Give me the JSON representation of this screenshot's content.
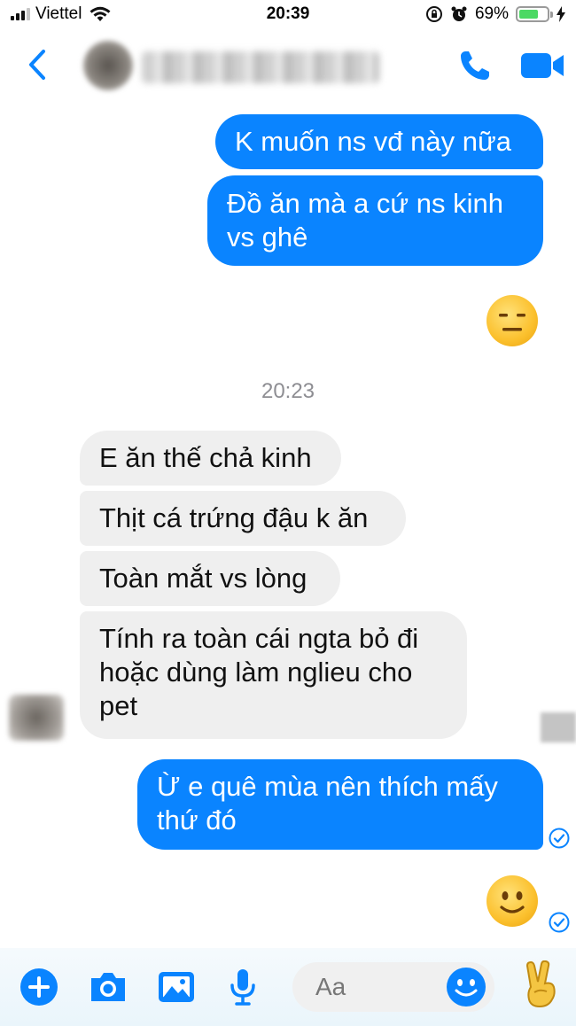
{
  "status_bar": {
    "carrier": "Viettel",
    "time": "20:39",
    "battery_percent": "69%",
    "battery_level": 0.69,
    "icons": [
      "signal-icon",
      "wifi-icon",
      "orientation-lock-icon",
      "alarm-icon",
      "battery-icon",
      "charging-bolt-icon"
    ]
  },
  "header": {
    "icons": [
      "back-chevron-icon",
      "phone-icon",
      "video-camera-icon"
    ]
  },
  "colors": {
    "accent": "#0a84ff",
    "incoming_bubble": "#efefef",
    "timestamp": "#8e8e93"
  },
  "messages": [
    {
      "direction": "out",
      "text": "K muốn ns vđ này nữa"
    },
    {
      "direction": "out",
      "text": "Đồ ăn mà a cứ ns kinh vs ghê"
    },
    {
      "direction": "out",
      "emoji": "expressionless-face-icon"
    },
    {
      "timestamp": "20:23"
    },
    {
      "direction": "in",
      "text": "E ăn thế chả kinh"
    },
    {
      "direction": "in",
      "text": "Thịt cá trứng đậu k ăn"
    },
    {
      "direction": "in",
      "text": "Toàn mắt vs lòng"
    },
    {
      "direction": "in",
      "text": "Tính ra toàn cái ngta bỏ đi hoặc dùng làm nglieu cho pet"
    },
    {
      "direction": "out",
      "text": "Ừ e quê mùa nên thích mấy thứ đó"
    },
    {
      "direction": "out",
      "emoji": "slightly-smiling-face-icon"
    }
  ],
  "composer": {
    "placeholder": "Aa",
    "icons": [
      "plus-icon",
      "camera-icon",
      "photo-icon",
      "microphone-icon",
      "emoji-icon",
      "victory-hand-icon"
    ]
  }
}
